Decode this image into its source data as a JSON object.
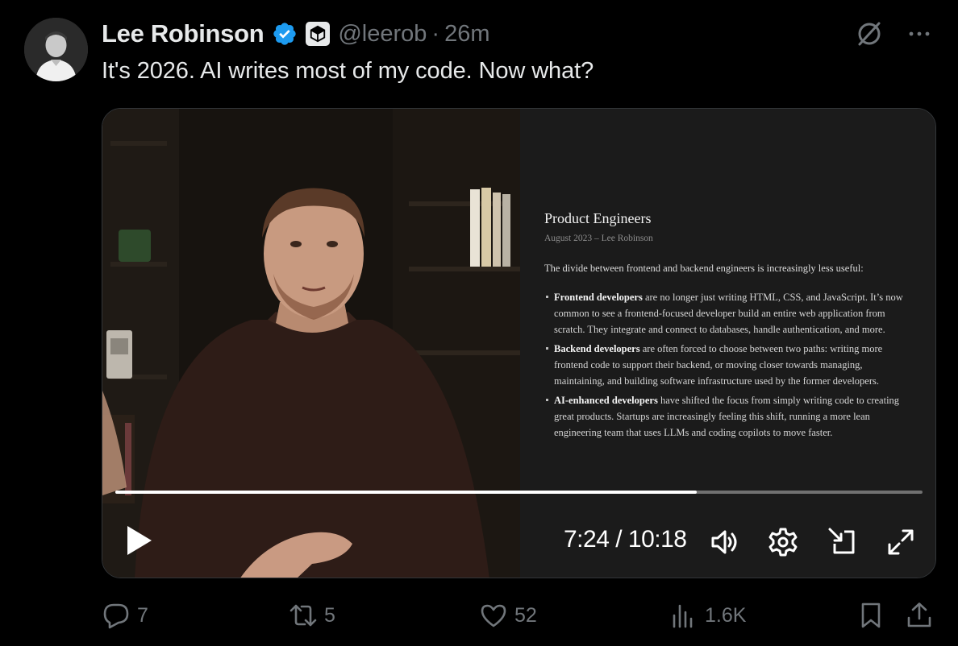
{
  "tweet": {
    "author_name": "Lee Robinson",
    "handle": "@leerob",
    "separator": "·",
    "time": "26m",
    "text": "It's 2026. AI writes most of my code. Now what?"
  },
  "icons": {
    "verified": "verified-badge-icon",
    "affiliation": "cursor-logo-icon",
    "grok": "grok-icon",
    "more": "more-icon"
  },
  "video": {
    "time_current": "7:24",
    "time_separator": "/",
    "time_total": "10:18",
    "progress": 0.72,
    "controls": [
      "play-icon",
      "volume-icon",
      "settings-icon",
      "picture-in-picture-icon",
      "fullscreen-icon"
    ]
  },
  "document": {
    "title": "Product Engineers",
    "meta": "August 2023 – Lee Robinson",
    "intro": "The divide between frontend and backend engineers is increasingly less useful:",
    "items": [
      {
        "bold": "Frontend developers",
        "text": " are no longer just writing HTML, CSS, and JavaScript. It’s now common to see a frontend-focused developer build an entire web application from scratch. They integrate and connect to databases, handle authentication, and more."
      },
      {
        "bold": "Backend developers",
        "text": " are often forced to choose between two paths: writing more frontend code to support their backend, or moving closer towards managing, maintaining, and building software infrastructure used by the former developers."
      },
      {
        "bold": "AI-enhanced developers",
        "text": " have shifted the focus from simply writing code to creating great products. Startups are increasingly feeling this shift, running a more lean engineering team that uses LLMs and coding copilots to move faster."
      }
    ]
  },
  "actions": {
    "replies": "7",
    "reposts": "5",
    "likes": "52",
    "views": "1.6K"
  },
  "colors": {
    "background": "#000000",
    "text": "#e7e9ea",
    "muted": "#71767b",
    "verified": "#1d9bf0",
    "border": "#333639"
  }
}
